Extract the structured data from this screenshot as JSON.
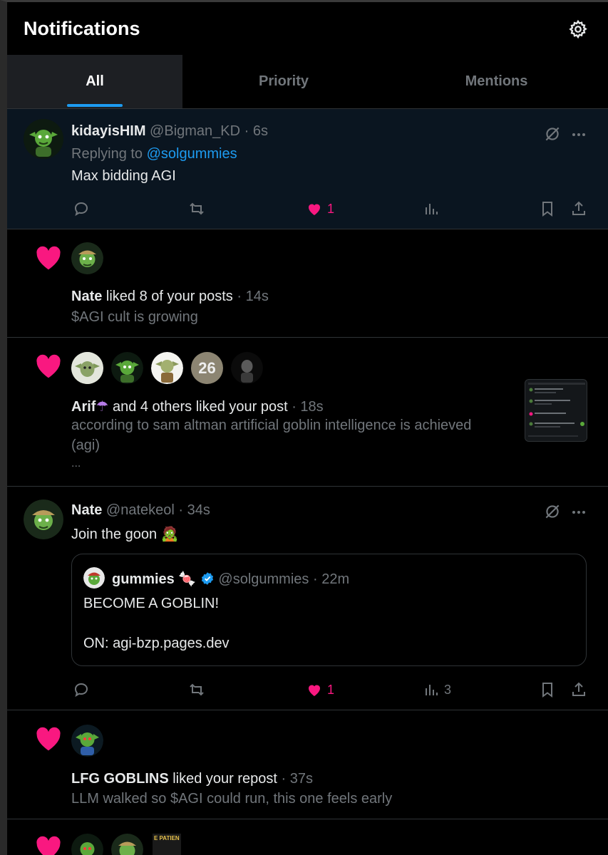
{
  "header": {
    "title": "Notifications",
    "settings_icon": "gear-icon"
  },
  "tabs": [
    {
      "label": "All",
      "active": true
    },
    {
      "label": "Priority",
      "active": false
    },
    {
      "label": "Mentions",
      "active": false
    }
  ],
  "post1": {
    "name": "kidayisHIM",
    "handle": "@Bigman_KD",
    "time": "· 6s",
    "replying_prefix": "Replying to",
    "replying_to": "@solgummies",
    "text": "Max bidding AGI",
    "likes": "1"
  },
  "notif1": {
    "name": "Nate",
    "action": "liked 8 of your posts",
    "time": "· 14s",
    "preview": "$AGI cult is growing"
  },
  "notif2": {
    "name": "Arif",
    "emoji": "☂",
    "action": "and 4 others liked your post",
    "time": "· 18s",
    "preview_line1": "according to sam altman artificial goblin intelligence is achieved",
    "preview_line2": "(agi)",
    "preview_more": "...",
    "badge_text": "26"
  },
  "post2": {
    "name": "Nate",
    "handle": "@natekeol",
    "time": "· 34s",
    "text": "Join the goon",
    "emoji": "🧟",
    "quote": {
      "name": "gummies",
      "emoji": "🍬",
      "handle": "@solgummies",
      "time": "· 22m",
      "line1": "BECOME A GOBLIN!",
      "line2": "ON: agi-bzp.pages.dev"
    },
    "likes": "1",
    "views": "3"
  },
  "notif3": {
    "name": "LFG GOBLINS",
    "action": "liked your repost",
    "time": "· 37s",
    "preview": "LLM walked so $AGI could run, this one feels early"
  },
  "notif4": {
    "badge_text": "E PATIEN"
  },
  "colors": {
    "accent": "#1d9bf0",
    "like": "#f91880",
    "muted": "#71767b",
    "text": "#e7e9ea",
    "highlight_bg": "#0a1520"
  }
}
